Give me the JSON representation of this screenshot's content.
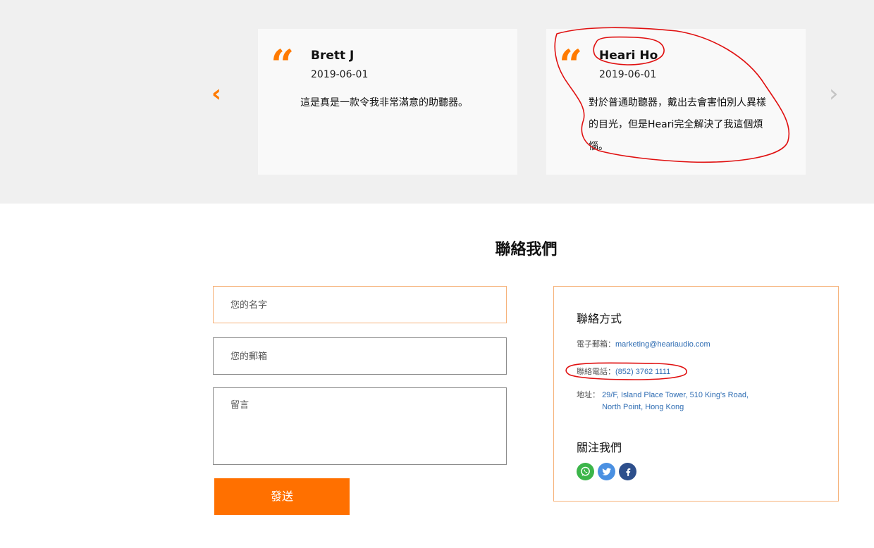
{
  "testimonials": {
    "items": [
      {
        "name": "Brett J",
        "date": "2019-06-01",
        "text": "這是真是一款令我非常滿意的助聽器。"
      },
      {
        "name": "Heari Ho",
        "date": "2019-06-01",
        "text": "對於普通助聽器，戴出去會害怕別人異樣的目光，但是Heari完全解決了我這個煩惱。"
      }
    ],
    "prev_arrow": "‹",
    "next_arrow": "›",
    "quote_mark": "❝"
  },
  "contact": {
    "title": "聯絡我們",
    "form": {
      "name_placeholder": "您的名字",
      "email_placeholder": "您的郵箱",
      "message_placeholder": "留言",
      "send_label": "發送"
    },
    "info": {
      "heading": "聯絡方式",
      "email_label": "電子郵箱：",
      "email_value": "marketing@heariaudio.com",
      "phone_label": "聯絡電話：",
      "phone_value": "(852) 3762 1111",
      "address_label": "地址：",
      "address_line1": "29/F, Island Place Tower, 510 King's Road,",
      "address_line2": "North Point, Hong Kong",
      "follow_heading": "關注我們",
      "socials": [
        {
          "icon": "whatsapp-icon",
          "color": "#3cb54a"
        },
        {
          "icon": "twitter-icon",
          "color": "#4a90e2"
        },
        {
          "icon": "facebook-icon",
          "color": "#2d4f8c"
        }
      ]
    }
  },
  "colors": {
    "accent": "#ff7000",
    "card_bg": "#f9f9f9",
    "band_bg": "#f0f0f0",
    "annotation": "#e01010"
  }
}
